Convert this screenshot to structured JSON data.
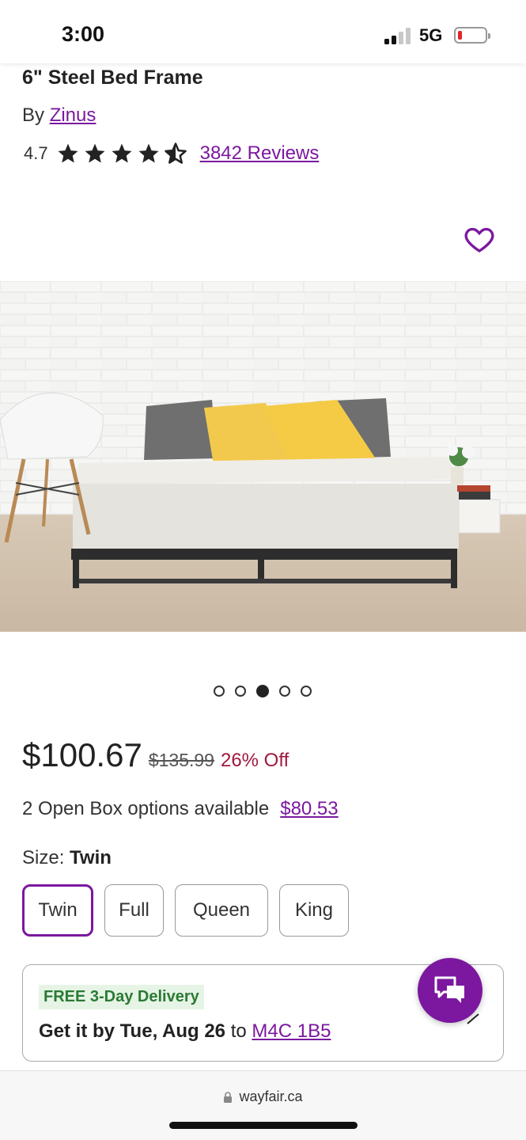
{
  "status_bar": {
    "time": "3:00",
    "network": "5G"
  },
  "product": {
    "title": "6\" Steel Bed Frame",
    "by_prefix": "By ",
    "brand": "Zinus",
    "rating": "4.7",
    "rating_value": 4.7,
    "reviews": "3842 Reviews"
  },
  "gallery": {
    "total": 5,
    "active_index": 2
  },
  "pricing": {
    "price": "$100.67",
    "old_price": "$135.99",
    "discount": "26% Off",
    "open_box_text": "2 Open Box options available",
    "open_box_price": "$80.53"
  },
  "size": {
    "label": "Size: ",
    "selected": "Twin",
    "options": [
      "Twin",
      "Full",
      "Queen",
      "King"
    ]
  },
  "delivery": {
    "badge": "FREE 3-Day Delivery",
    "get_it_by": "Get it by Tue, Aug 26",
    "to": " to ",
    "zip": "M4C 1B5"
  },
  "browser": {
    "url": "wayfair.ca"
  },
  "colors": {
    "brand_purple": "#7b189f",
    "discount_red": "#a1183d",
    "delivery_green": "#2b7a34"
  }
}
